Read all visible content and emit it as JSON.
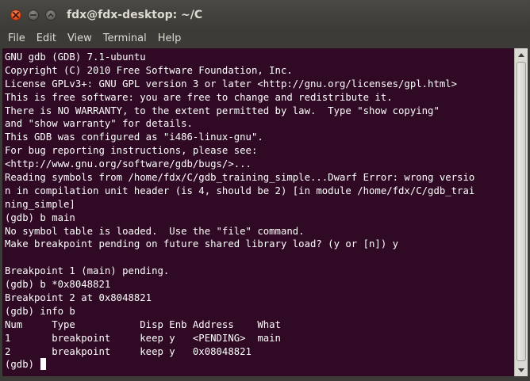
{
  "window": {
    "title": "fdx@fdx-desktop: ~/C"
  },
  "menu": {
    "items": [
      "File",
      "Edit",
      "View",
      "Terminal",
      "Help"
    ]
  },
  "terminal": {
    "lines": [
      "GNU gdb (GDB) 7.1-ubuntu",
      "Copyright (C) 2010 Free Software Foundation, Inc.",
      "License GPLv3+: GNU GPL version 3 or later <http://gnu.org/licenses/gpl.html>",
      "This is free software: you are free to change and redistribute it.",
      "There is NO WARRANTY, to the extent permitted by law.  Type \"show copying\"",
      "and \"show warranty\" for details.",
      "This GDB was configured as \"i486-linux-gnu\".",
      "For bug reporting instructions, please see:",
      "<http://www.gnu.org/software/gdb/bugs/>...",
      "Reading symbols from /home/fdx/C/gdb_training_simple...Dwarf Error: wrong versio",
      "n in compilation unit header (is 4, should be 2) [in module /home/fdx/C/gdb_trai",
      "ning_simple]",
      "(gdb) b main",
      "No symbol table is loaded.  Use the \"file\" command.",
      "Make breakpoint pending on future shared library load? (y or [n]) y",
      "",
      "Breakpoint 1 (main) pending.",
      "(gdb) b *0x8048821",
      "Breakpoint 2 at 0x8048821",
      "(gdb) info b",
      "Num     Type           Disp Enb Address    What",
      "1       breakpoint     keep y   <PENDING>  main",
      "2       breakpoint     keep y   0x08048821"
    ],
    "prompt": "(gdb) "
  },
  "colors": {
    "terminal_bg": "#300a24",
    "terminal_fg": "#ffffff",
    "chrome": "#3c3b37",
    "close_button": "#df4a16"
  }
}
